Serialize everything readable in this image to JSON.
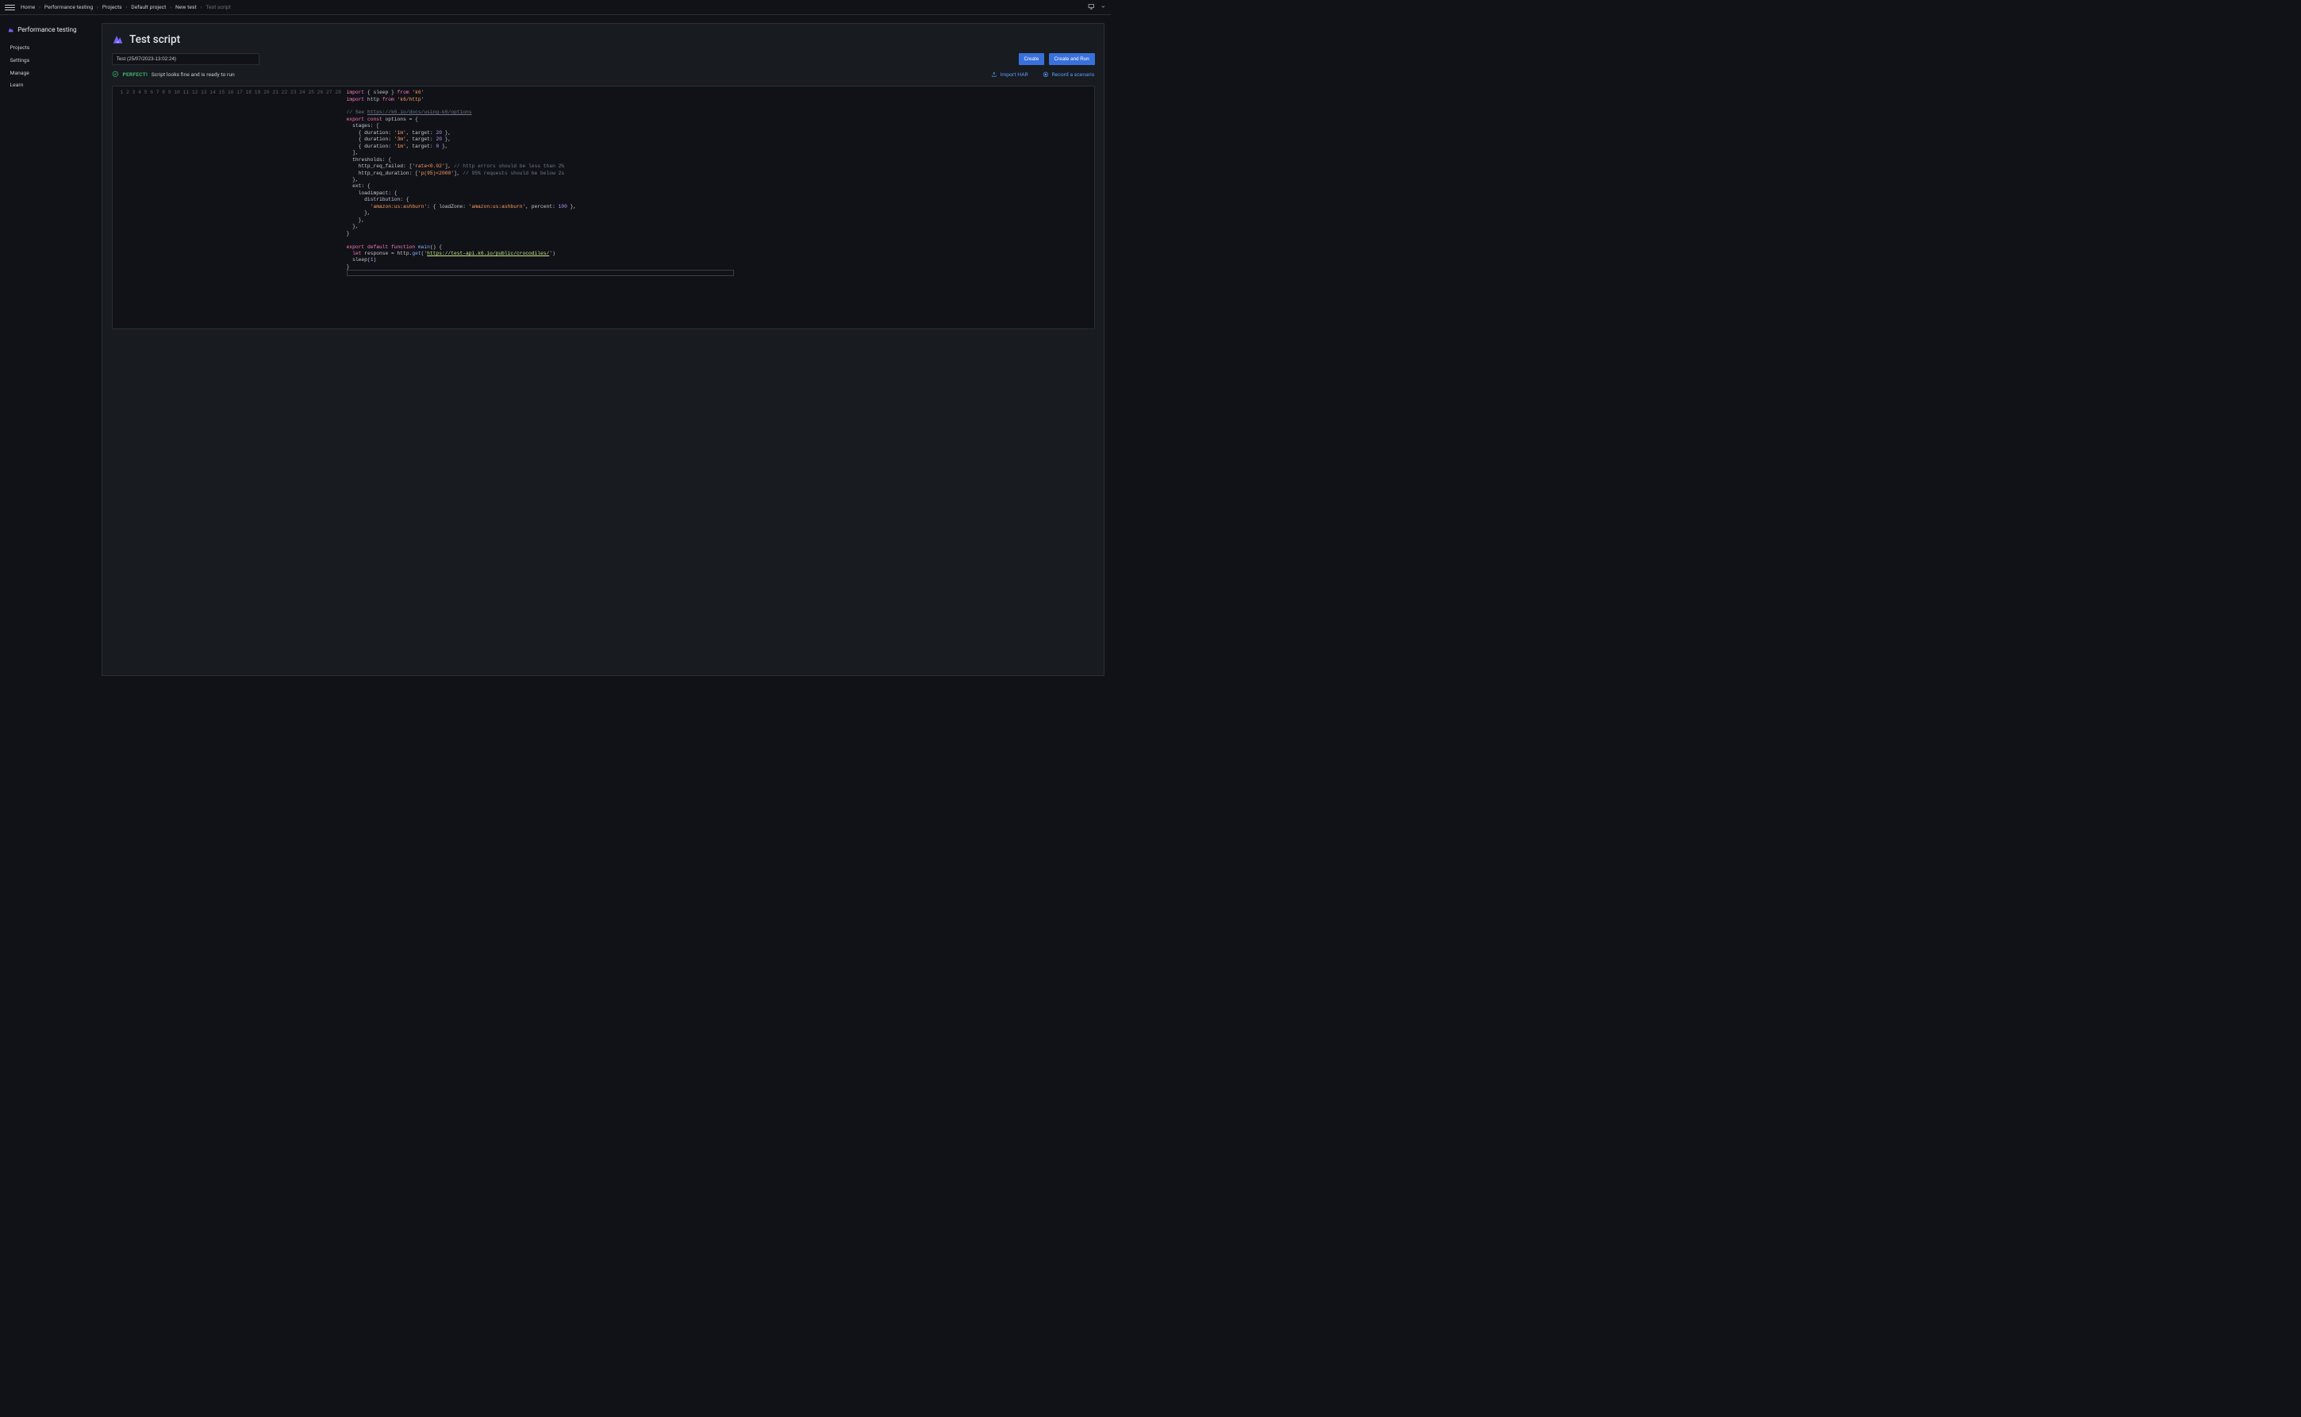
{
  "breadcrumb": [
    "Home",
    "Performance testing",
    "Projects",
    "Default project",
    "New test",
    "Test script"
  ],
  "sidebar": {
    "title": "Performance testing",
    "items": [
      "Projects",
      "Settings",
      "Manage",
      "Learn"
    ]
  },
  "page": {
    "title": "Test script"
  },
  "toolbar": {
    "test_name": "Test (25/07/2023-13:02:24)",
    "create": "Create",
    "create_run": "Create and Run"
  },
  "status": {
    "badge": "PERFECT!",
    "text": "Script looks fine and is ready to run"
  },
  "actions": {
    "import_har": "Import HAR",
    "record": "Record a scenario"
  },
  "code": {
    "line_count": 28,
    "l1a": "import",
    "l1b": " { sleep } ",
    "l1c": "from",
    "l1d": " ",
    "l1e": "'k6'",
    "l2a": "import",
    "l2b": " http ",
    "l2c": "from",
    "l2d": " ",
    "l2e": "'k6/http'",
    "l4a": "// See ",
    "l4b": "https://k6.io/docs/using-k6/options",
    "l5a": "export",
    "l5b": " ",
    "l5c": "const",
    "l5d": " options = {",
    "l6": "  stages: [",
    "l7a": "    { duration: ",
    "l7b": "'1m'",
    "l7c": ", target: ",
    "l7d": "20",
    "l7e": " },",
    "l8a": "    { duration: ",
    "l8b": "'3m'",
    "l8c": ", target: ",
    "l8d": "20",
    "l8e": " },",
    "l9a": "    { duration: ",
    "l9b": "'1m'",
    "l9c": ", target: ",
    "l9d": "0",
    "l9e": " },",
    "l10": "  ],",
    "l11": "  thresholds: {",
    "l12a": "    http_req_failed: [",
    "l12b": "'rate<0.02'",
    "l12c": "], ",
    "l12d": "// http errors should be less than 2%",
    "l13a": "    http_req_duration: [",
    "l13b": "'p(95)<2000'",
    "l13c": "], ",
    "l13d": "// 95% requests should be below 2s",
    "l14": "  },",
    "l15": "  ext: {",
    "l16": "    loadimpact: {",
    "l17": "      distribution: {",
    "l18a": "        ",
    "l18b": "'amazon:us:ashburn'",
    "l18c": ": { loadZone: ",
    "l18d": "'amazon:us:ashburn'",
    "l18e": ", percent: ",
    "l18f": "100",
    "l18g": " },",
    "l19": "      },",
    "l20": "    },",
    "l21": "  },",
    "l22": "}",
    "l24a": "export",
    "l24b": " ",
    "l24c": "default",
    "l24d": " ",
    "l24e": "function",
    "l24f": " ",
    "l24g": "main",
    "l24h": "() {",
    "l25a": "  ",
    "l25b": "let",
    "l25c": " response = http.",
    "l25d": "get",
    "l25e": "(",
    "l25f": "'",
    "l25g": "https://test-api.k6.io/public/crocodiles/",
    "l25h": "'",
    "l25i": ")",
    "l26a": "  sleep(",
    "l26b": "1",
    "l26c": ")",
    "l27": "}"
  }
}
